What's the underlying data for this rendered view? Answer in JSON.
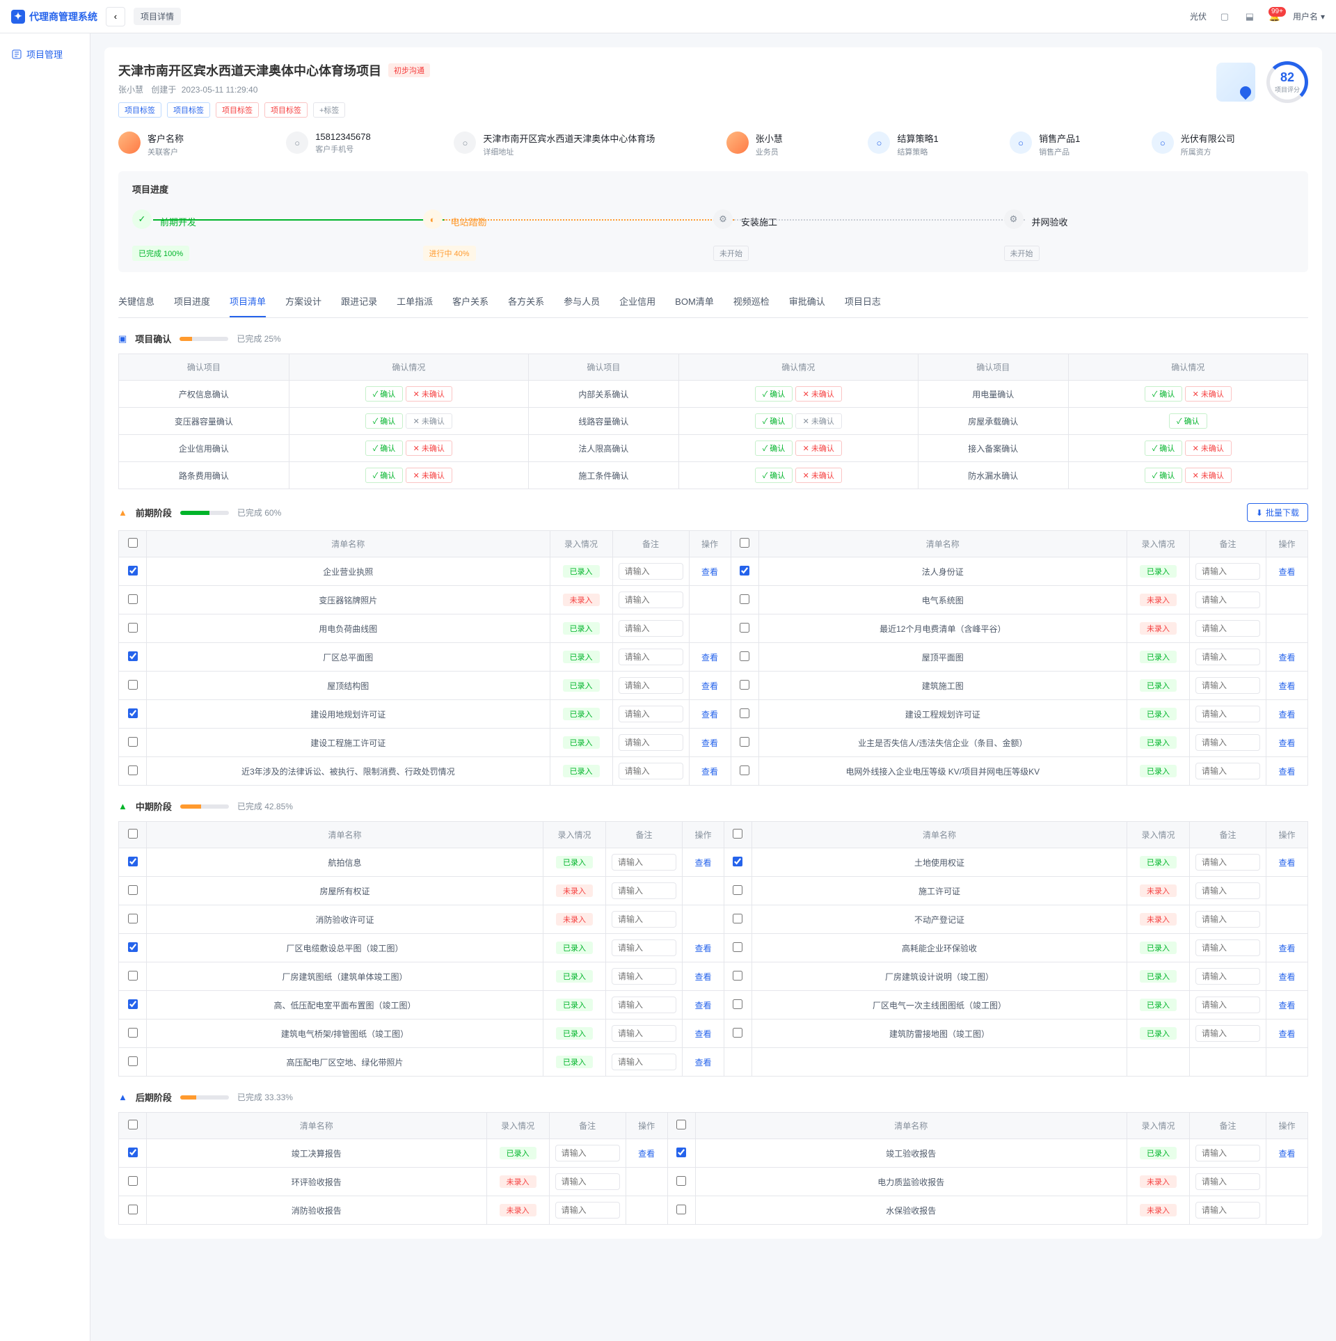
{
  "app": {
    "name": "代理商管理系统",
    "breadcrumb": "项目详情",
    "tenant": "光伏",
    "user": "用户名",
    "notif": "99+"
  },
  "sidebar": {
    "pm": "项目管理"
  },
  "project": {
    "title": "天津市南开区宾水西道天津奥体中心体育场项目",
    "status": "初步沟通",
    "creator": "张小慧",
    "created_prefix": "创建于",
    "created_at": "2023-05-11 11:29:40",
    "tags": [
      "项目标签",
      "项目标签",
      "项目标签",
      "项目标签"
    ],
    "add_tag": "+标签",
    "score": 82,
    "score_label": "项目评分"
  },
  "info": [
    {
      "v": "客户名称",
      "l": "关联客户"
    },
    {
      "v": "15812345678",
      "l": "客户手机号"
    },
    {
      "v": "天津市南开区宾水西道天津奥体中心体育场",
      "l": "详细地址"
    },
    {
      "v": "张小慧",
      "l": "业务员"
    },
    {
      "v": "结算策略1",
      "l": "结算策略"
    },
    {
      "v": "销售产品1",
      "l": "销售产品"
    },
    {
      "v": "光伏有限公司",
      "l": "所属资方"
    }
  ],
  "progress": {
    "title": "项目进度",
    "steps": [
      {
        "name": "前期开发",
        "status": "已完成",
        "pct": "100%",
        "state": "done"
      },
      {
        "name": "电站踏勘",
        "status": "进行中",
        "pct": "40%",
        "state": "prog"
      },
      {
        "name": "安装施工",
        "status": "未开始",
        "pct": "",
        "state": "wait"
      },
      {
        "name": "并网验收",
        "status": "未开始",
        "pct": "",
        "state": "wait"
      }
    ]
  },
  "tabs": [
    "关键信息",
    "项目进度",
    "项目清单",
    "方案设计",
    "跟进记录",
    "工单指派",
    "客户关系",
    "各方关系",
    "参与人员",
    "企业信用",
    "BOM清单",
    "视频巡检",
    "审批确认",
    "项目日志"
  ],
  "active_tab": 2,
  "txt": {
    "confirm_item": "确认项目",
    "confirm_state": "确认情况",
    "list_name": "清单名称",
    "record": "录入情况",
    "note": "备注",
    "op": "操作",
    "view": "查看",
    "input_ph": "请输入",
    "ok": "确认",
    "no": "未确认",
    "done": "已录入",
    "undone": "未录入",
    "download": "批量下载"
  },
  "sections": {
    "confirm": {
      "title": "项目确认",
      "pct": 25,
      "pct_txt": "已完成 25%"
    },
    "early": {
      "title": "前期阶段",
      "pct": 60,
      "pct_txt": "已完成 60%"
    },
    "mid": {
      "title": "中期阶段",
      "pct": 42.85,
      "pct_txt": "已完成 42.85%"
    },
    "late": {
      "title": "后期阶段",
      "pct": 33.33,
      "pct_txt": "已完成 33.33%"
    }
  },
  "confirm_rows": [
    {
      "a": "产权信息确认",
      "as": "okno",
      "b": "内部关系确认",
      "bs": "okno",
      "c": "用电量确认",
      "cs": "okno"
    },
    {
      "a": "变压器容量确认",
      "as": "okgrey",
      "b": "线路容量确认",
      "bs": "okgrey",
      "c": "房屋承载确认",
      "cs": "ok"
    },
    {
      "a": "企业信用确认",
      "as": "okno",
      "b": "法人限高确认",
      "bs": "okno",
      "c": "接入备案确认",
      "cs": "okno"
    },
    {
      "a": "路条费用确认",
      "as": "okno",
      "b": "施工条件确认",
      "bs": "okno",
      "c": "防水漏水确认",
      "cs": "okno"
    }
  ],
  "early_rows": [
    {
      "l": {
        "cb": true,
        "name": "企业营业执照",
        "rec": "done",
        "view": true
      },
      "r": {
        "cb": true,
        "name": "法人身份证",
        "rec": "done",
        "view": true
      }
    },
    {
      "l": {
        "cb": false,
        "name": "变压器铭牌照片",
        "rec": "undone",
        "view": false
      },
      "r": {
        "cb": false,
        "name": "电气系统图",
        "rec": "undone",
        "view": false
      }
    },
    {
      "l": {
        "cb": false,
        "name": "用电负荷曲线图",
        "rec": "done",
        "view": false
      },
      "r": {
        "cb": false,
        "name": "最近12个月电费清单（含峰平谷）",
        "rec": "undone",
        "view": false
      }
    },
    {
      "l": {
        "cb": true,
        "name": "厂区总平面图",
        "rec": "done",
        "view": true
      },
      "r": {
        "cb": false,
        "name": "屋顶平面图",
        "rec": "done",
        "view": true
      }
    },
    {
      "l": {
        "cb": false,
        "name": "屋顶结构图",
        "rec": "done",
        "view": true
      },
      "r": {
        "cb": false,
        "name": "建筑施工图",
        "rec": "done",
        "view": true
      }
    },
    {
      "l": {
        "cb": true,
        "name": "建设用地规划许可证",
        "rec": "done",
        "view": true
      },
      "r": {
        "cb": false,
        "name": "建设工程规划许可证",
        "rec": "done",
        "view": true
      }
    },
    {
      "l": {
        "cb": false,
        "name": "建设工程施工许可证",
        "rec": "done",
        "view": true
      },
      "r": {
        "cb": false,
        "name": "业主是否失信人/违法失信企业（条目、金额）",
        "rec": "done",
        "view": true
      }
    },
    {
      "l": {
        "cb": false,
        "name": "近3年涉及的法律诉讼、被执行、限制消费、行政处罚情况",
        "rec": "done",
        "view": true
      },
      "r": {
        "cb": false,
        "name": "电网外线接入企业电压等级 KV/项目并网电压等级KV",
        "rec": "done",
        "view": true
      }
    }
  ],
  "mid_rows": [
    {
      "l": {
        "cb": true,
        "name": "航拍信息",
        "rec": "done",
        "view": true
      },
      "r": {
        "cb": true,
        "name": "土地使用权证",
        "rec": "done",
        "view": true
      }
    },
    {
      "l": {
        "cb": false,
        "name": "房屋所有权证",
        "rec": "undone",
        "view": false
      },
      "r": {
        "cb": false,
        "name": "施工许可证",
        "rec": "undone",
        "view": false
      }
    },
    {
      "l": {
        "cb": false,
        "name": "消防验收许可证",
        "rec": "undone",
        "view": false
      },
      "r": {
        "cb": false,
        "name": "不动产登记证",
        "rec": "undone",
        "view": false
      }
    },
    {
      "l": {
        "cb": true,
        "name": "厂区电缆敷设总平图（竣工图）",
        "rec": "done",
        "view": true
      },
      "r": {
        "cb": false,
        "name": "高耗能企业环保验收",
        "rec": "done",
        "view": true
      }
    },
    {
      "l": {
        "cb": false,
        "name": "厂房建筑图纸（建筑单体竣工图）",
        "rec": "done",
        "view": true
      },
      "r": {
        "cb": false,
        "name": "厂房建筑设计说明（竣工图）",
        "rec": "done",
        "view": true
      }
    },
    {
      "l": {
        "cb": true,
        "name": "高、低压配电室平面布置图（竣工图）",
        "rec": "done",
        "view": true
      },
      "r": {
        "cb": false,
        "name": "厂区电气一次主线图图纸（竣工图）",
        "rec": "done",
        "view": true
      }
    },
    {
      "l": {
        "cb": false,
        "name": "建筑电气桥架/排管图纸（竣工图）",
        "rec": "done",
        "view": true
      },
      "r": {
        "cb": false,
        "name": "建筑防雷接地图（竣工图）",
        "rec": "done",
        "view": true
      }
    },
    {
      "l": {
        "cb": false,
        "name": "高压配电厂区空地、绿化带照片",
        "rec": "done",
        "view": true
      },
      "r": null
    }
  ],
  "late_rows": [
    {
      "l": {
        "cb": true,
        "name": "竣工决算报告",
        "rec": "done",
        "view": true
      },
      "r": {
        "cb": true,
        "name": "竣工验收报告",
        "rec": "done",
        "view": true
      }
    },
    {
      "l": {
        "cb": false,
        "name": "环评验收报告",
        "rec": "undone",
        "view": false
      },
      "r": {
        "cb": false,
        "name": "电力质监验收报告",
        "rec": "undone",
        "view": false
      }
    },
    {
      "l": {
        "cb": false,
        "name": "消防验收报告",
        "rec": "undone",
        "view": false
      },
      "r": {
        "cb": false,
        "name": "水保验收报告",
        "rec": "undone",
        "view": false
      }
    }
  ]
}
